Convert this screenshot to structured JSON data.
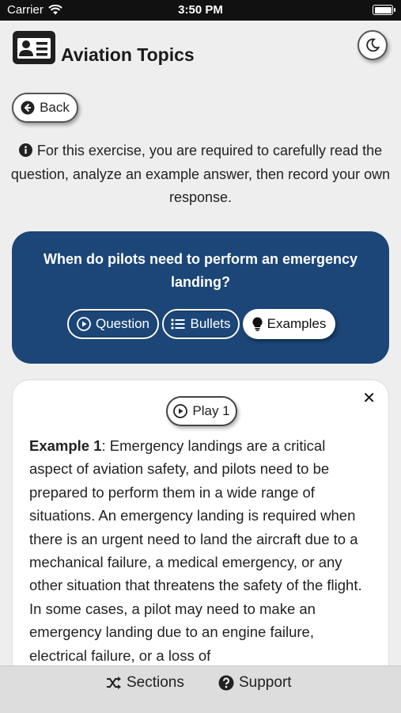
{
  "status_bar": {
    "carrier": "Carrier",
    "time": "3:50 PM"
  },
  "header": {
    "title": "Aviation Topics",
    "app_icon": "id-card-icon",
    "theme_toggle_icon": "moon-icon"
  },
  "back_button": {
    "label": "Back",
    "icon": "arrow-left-circle-icon"
  },
  "instructions": {
    "icon": "info-circle-icon",
    "text": "For this exercise, you are required to carefully read the question, analyze an example answer, then record your own response."
  },
  "question_card": {
    "question": "When do pilots need to perform an emergency landing?",
    "background_color": "#1b4677",
    "tabs": [
      {
        "label": "Question",
        "icon": "play-circle-icon",
        "active": false
      },
      {
        "label": "Bullets",
        "icon": "list-icon",
        "active": false
      },
      {
        "label": "Examples",
        "icon": "lightbulb-icon",
        "active": true
      }
    ]
  },
  "example_card": {
    "close_icon": "close-icon",
    "play_button_label": "Play 1",
    "example_heading": "Example 1",
    "example_body": ": Emergency landings are a critical aspect of aviation safety, and pilots need to be prepared to perform them in a wide range of situations. An emergency landing is required when there is an urgent need to land the aircraft due to a mechanical failure, a medical emergency, or any other situation that threatens the safety of the flight. In some cases, a pilot may need to make an emergency landing due to an engine failure, electrical failure, or a loss of"
  },
  "tab_bar": {
    "items": [
      {
        "label": "Sections",
        "icon": "shuffle-icon"
      },
      {
        "label": "Support",
        "icon": "question-circle-icon"
      }
    ]
  }
}
